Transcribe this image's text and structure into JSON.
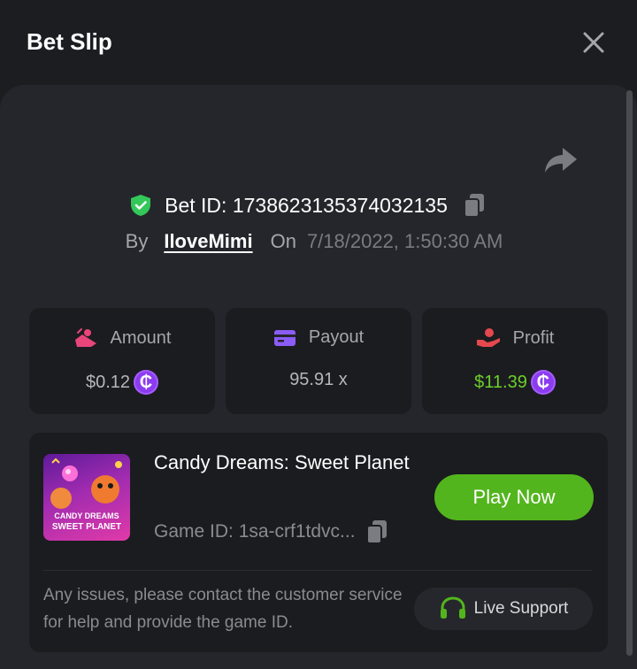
{
  "header": {
    "title": "Bet Slip"
  },
  "bet": {
    "id_text": "Bet ID: 1738623135374032135",
    "by_label": "By",
    "username": "IloveMimi",
    "on_label": "On",
    "date": "7/18/2022, 1:50:30 AM"
  },
  "stats": {
    "amount_label": "Amount",
    "amount_value": "$0.12",
    "payout_label": "Payout",
    "payout_value": "95.91 x",
    "profit_label": "Profit",
    "profit_value": "$11.39",
    "coin_symbol": "₵"
  },
  "game": {
    "name": "Candy Dreams: Sweet Planet",
    "id_text": "Game ID: 1sa-crf1tdvc...",
    "thumb_line1": "CANDY DREAMS",
    "thumb_line2": "SWEET PLANET",
    "play_label": "Play Now"
  },
  "support": {
    "text": "Any issues, please contact the customer service for help and provide the game ID.",
    "button_label": "Live Support"
  },
  "colors": {
    "accent_green": "#53b51d",
    "profit_green": "#6ccf2a",
    "coin_purple": "#8b3cf0",
    "shield_green": "#34c759",
    "amount_pink": "#e8457a",
    "payout_purple": "#8b5cf6",
    "profit_red": "#e5484d"
  },
  "icons": [
    "close-icon",
    "share-icon",
    "shield-check-icon",
    "copy-icon",
    "amount-icon",
    "payout-card-icon",
    "profit-hand-icon",
    "headset-icon"
  ]
}
